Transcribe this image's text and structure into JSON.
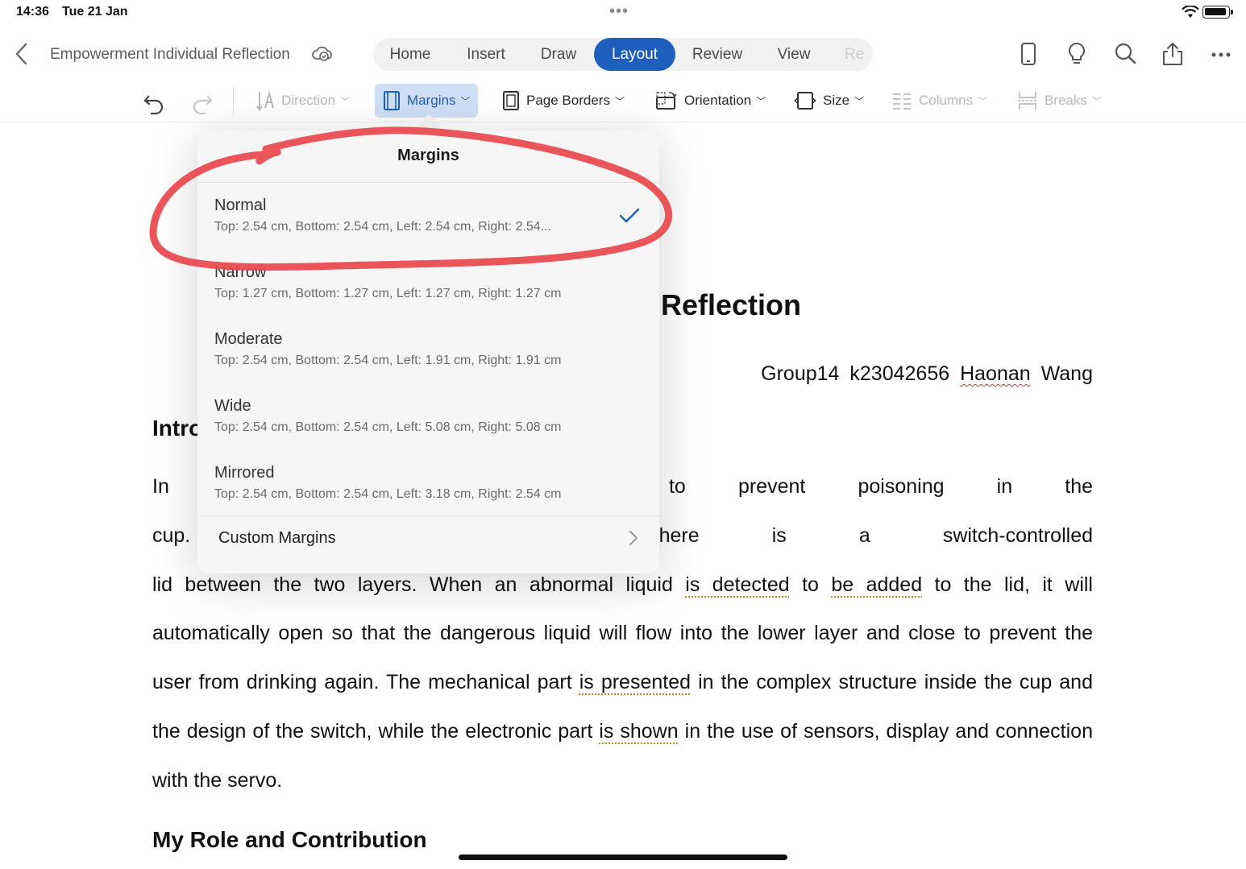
{
  "status_bar": {
    "time": "14:36",
    "date": "Tue 21 Jan",
    "dots": "•••"
  },
  "header": {
    "doc_title": "Empowerment Individual Reflection",
    "tabs": [
      "Home",
      "Insert",
      "Draw",
      "Layout",
      "Review",
      "View",
      "Re"
    ],
    "active_tab": "Layout"
  },
  "ribbon": {
    "direction": "Direction",
    "margins": "Margins",
    "page_borders": "Page Borders",
    "orientation": "Orientation",
    "size": "Size",
    "columns": "Columns",
    "breaks": "Breaks"
  },
  "margins_popover": {
    "title": "Margins",
    "options": [
      {
        "name": "Normal",
        "desc": "Top: 2.54 cm, Bottom: 2.54 cm, Left: 2.54 cm, Right: 2.54...",
        "selected": true
      },
      {
        "name": "Narrow",
        "desc": "Top: 1.27 cm, Bottom: 1.27 cm, Left: 1.27 cm, Right: 1.27 cm",
        "selected": false
      },
      {
        "name": "Moderate",
        "desc": "Top: 2.54 cm, Bottom: 2.54 cm, Left: 1.91 cm, Right: 1.91 cm",
        "selected": false
      },
      {
        "name": "Wide",
        "desc": "Top: 2.54 cm, Bottom: 2.54 cm, Left: 5.08 cm, Right: 5.08 cm",
        "selected": false
      },
      {
        "name": "Mirrored",
        "desc": "Top: 2.54 cm, Bottom: 2.54 cm, Left: 3.18 cm, Right: 2.54 cm",
        "selected": false
      }
    ],
    "custom": "Custom Margins"
  },
  "document": {
    "heading_visible": "Reflection",
    "author": {
      "group": "Group14",
      "id": "k23042656",
      "first": "Haonan",
      "last": "Wang"
    },
    "intro_visible": "Intro",
    "lines": {
      "l1_left": "In ou",
      "l1_right": "n a bar environment to prevent poisoning in the",
      "l2_left": "cup. ",
      "l2_right": "regular drinking, and there is a switch-controlled",
      "l3a": "lid between the two layers. When an abnormal liquid",
      "l3b": "is detected",
      "l3c": "to",
      "l3d": "be added",
      "l3e": "to the lid, it will",
      "l4": "automatically open so that the dangerous liquid will flow into the lower layer and close to prevent the",
      "l5a": "user from drinking again. The mechanical part",
      "l5b": "is presented",
      "l5c": "in the complex structure inside the cup and",
      "l6a": "the design of the switch, while the electronic part",
      "l6b": "is shown",
      "l6c": "in the use of sensors, display and connection",
      "l7": "with the servo."
    },
    "role_heading": "My Role and Contribution"
  },
  "colors": {
    "accent": "#1e5fbe",
    "annotation": "#e8474c"
  }
}
